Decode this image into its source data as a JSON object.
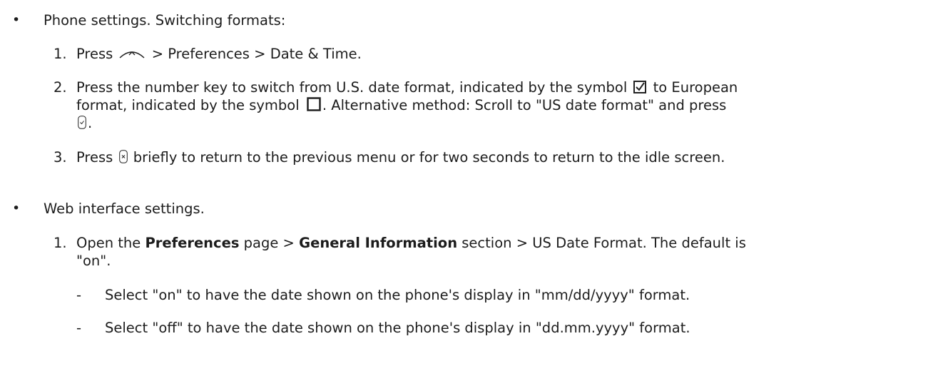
{
  "phone_section": {
    "bullet": "•",
    "heading": "Phone settings.  Switching formats:",
    "step1": {
      "number": "1.",
      "text_a": "Press",
      "icon": "up-arrow-key-icon",
      "text_b": " > Preferences > Date & Time."
    },
    "step2": {
      "number": "2.",
      "line1_a": "Press the number key to switch from U.S. date format, indicated by the symbol ",
      "icon_checked": "checked-box-icon",
      "line1_b": " to European",
      "line2_a": "format, indicated by the symbol ",
      "icon_unchecked": "empty-box-icon",
      "line2_b": ".  Alternative method:  Scroll to \"US date format\" and press",
      "icon_ok": "ok-key-icon",
      "line3_b": "."
    },
    "step3": {
      "number": "3.",
      "text_a": "Press ",
      "icon": "cancel-key-icon",
      "text_b": " briefly to return to the previous menu or for two seconds to return to the idle screen."
    }
  },
  "web_section": {
    "bullet": "•",
    "heading": "Web interface settings.",
    "step1": {
      "number": "1.",
      "text_a": "Open the ",
      "bold_a": "Preferences",
      "text_b": " page > ",
      "bold_b": "General Information",
      "text_c": " section > US Date Format.  The default is",
      "line2": "\"on\"."
    },
    "options": [
      {
        "dash": "-",
        "text": "Select \"on\" to have the date shown on the phone's display in \"mm/dd/yyyy\" format."
      },
      {
        "dash": "-",
        "text": "Select \"off\" to have the date shown on the phone's display in \"dd.mm.yyyy\" format."
      }
    ]
  }
}
